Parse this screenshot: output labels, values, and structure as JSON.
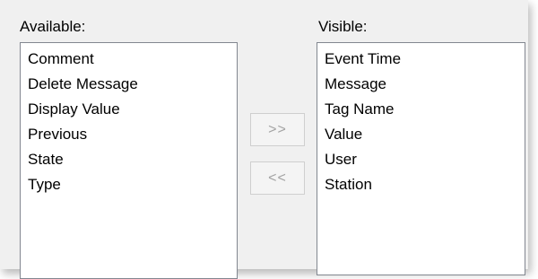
{
  "available": {
    "label": "Available:",
    "items": [
      "Comment",
      "Delete Message",
      "Display Value",
      "Previous",
      "State",
      "Type"
    ]
  },
  "visible": {
    "label": "Visible:",
    "items": [
      "Event Time",
      "Message",
      "Tag Name",
      "Value",
      "User",
      "Station"
    ]
  },
  "buttons": {
    "add_label": ">>",
    "remove_label": "<<",
    "add_enabled": false,
    "remove_enabled": false
  }
}
